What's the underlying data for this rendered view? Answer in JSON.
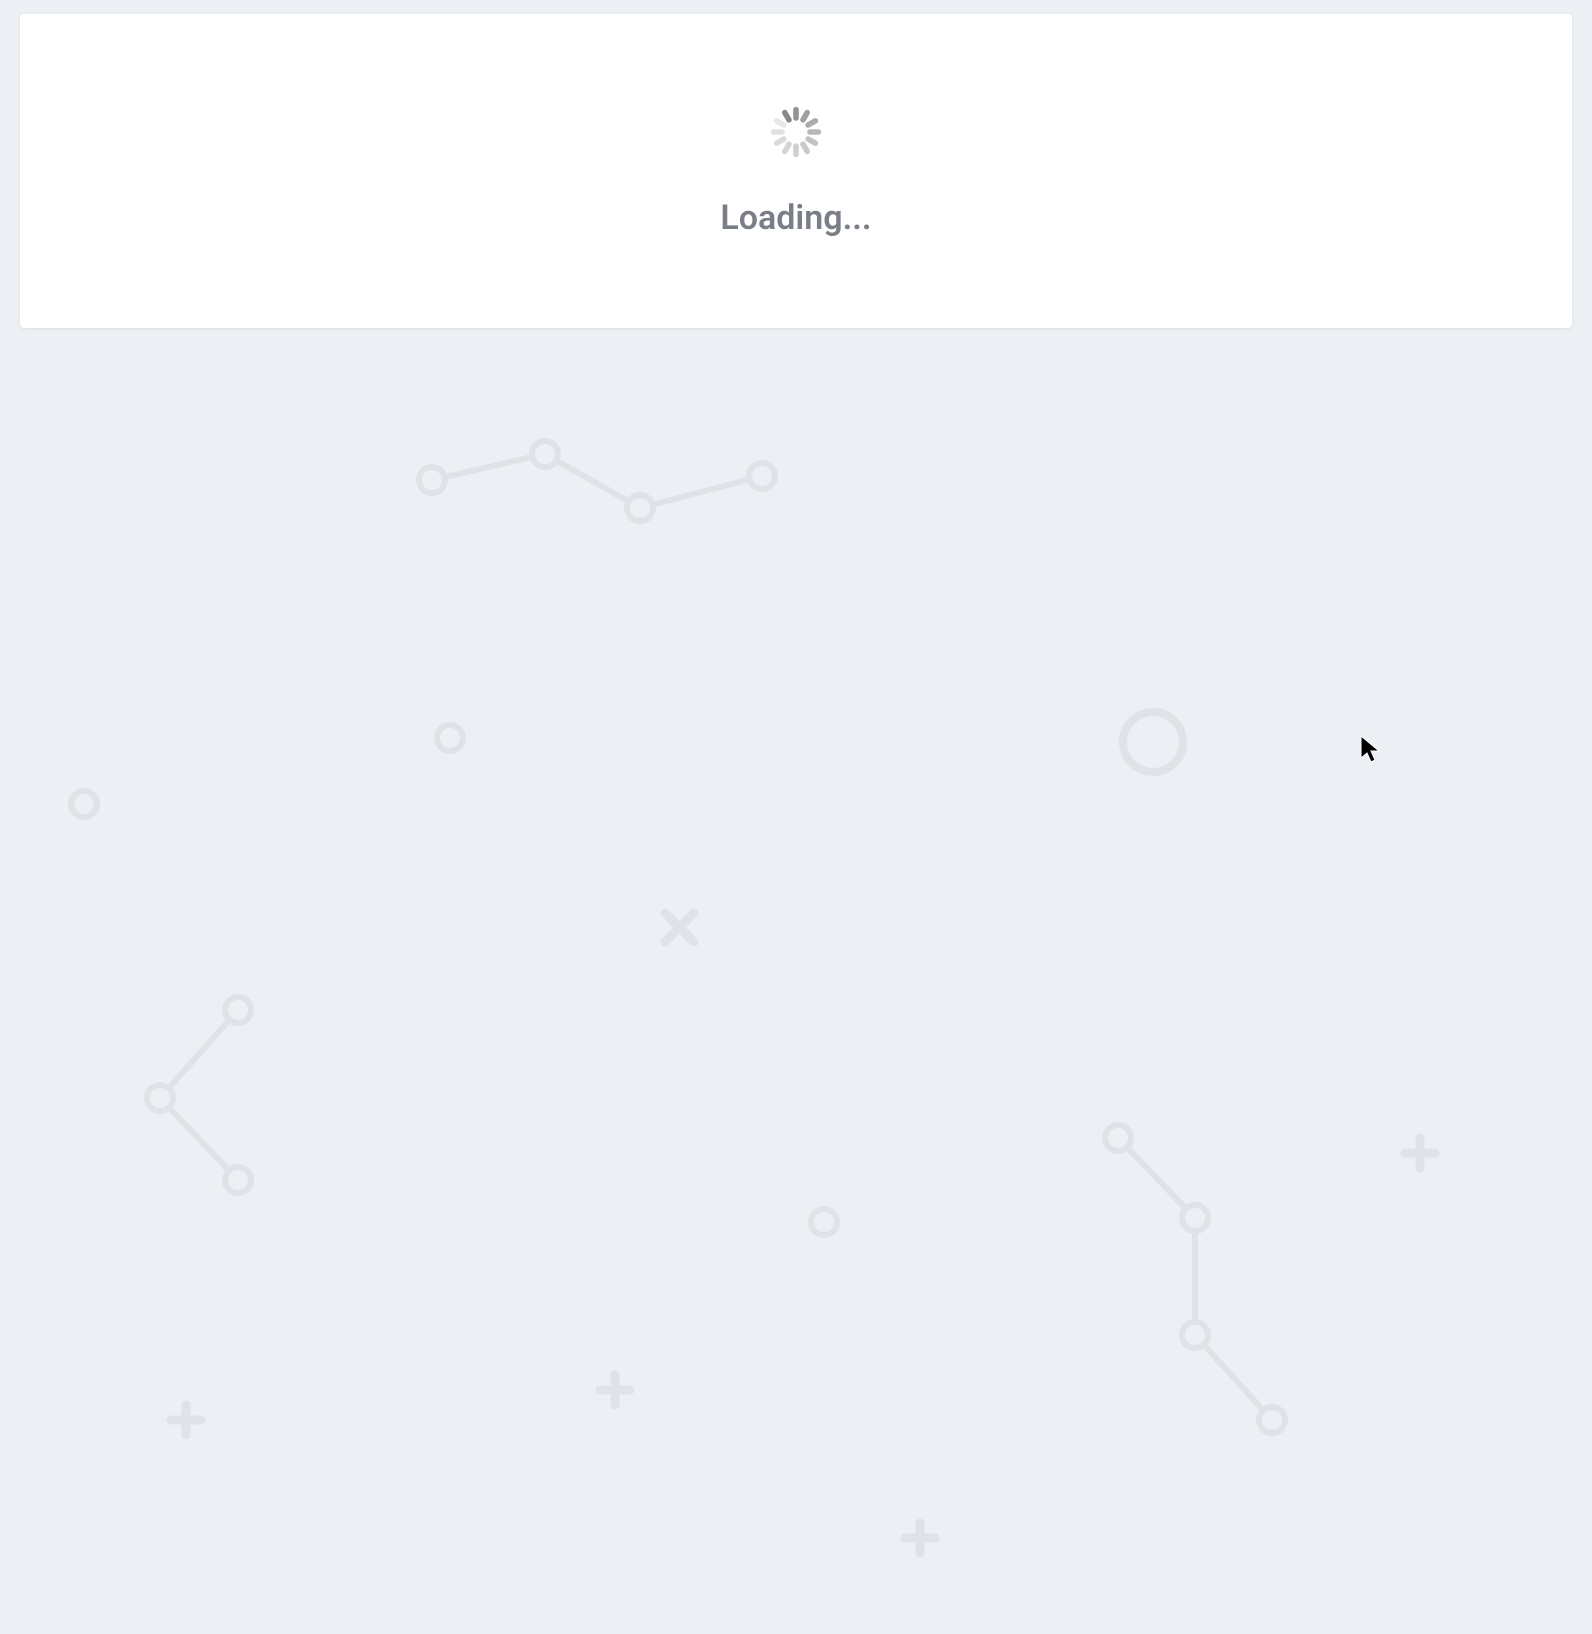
{
  "loading": {
    "text": "Loading..."
  },
  "colors": {
    "background": "#eceff3",
    "card": "#ffffff",
    "textMuted": "#7a7f87",
    "patternStroke": "#dfe3e8"
  }
}
